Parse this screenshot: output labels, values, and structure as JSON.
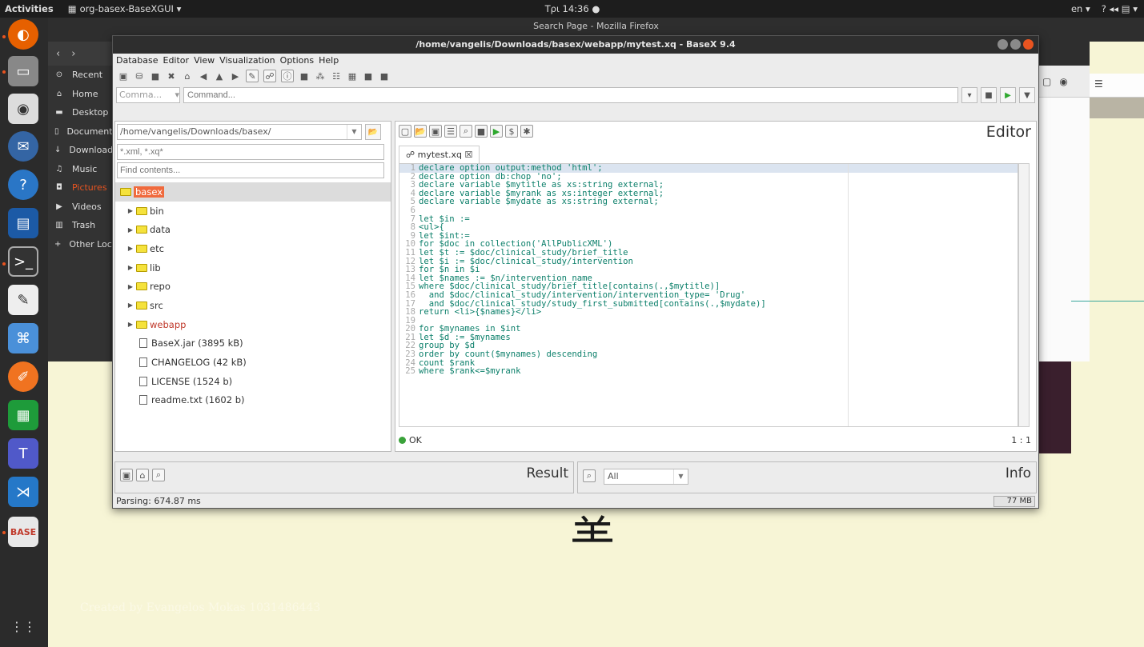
{
  "topbar": {
    "activities": "Activities",
    "app_name": "org-basex-BaseXGUI ▾",
    "clock": "Τρι 14:36 ●",
    "lang": "en ▾",
    "tray": "? ◂◂ ▤ ▾"
  },
  "firefox": {
    "title": "Search Page - Mozilla Firefox"
  },
  "files_sidebar": [
    {
      "icon": "⊙",
      "label": "Recent"
    },
    {
      "icon": "⌂",
      "label": "Home"
    },
    {
      "icon": "▬",
      "label": "Desktop"
    },
    {
      "icon": "▯",
      "label": "Documents"
    },
    {
      "icon": "↓",
      "label": "Downloads"
    },
    {
      "icon": "♫",
      "label": "Music"
    },
    {
      "icon": "◘",
      "label": "Pictures"
    },
    {
      "icon": "▶",
      "label": "Videos"
    },
    {
      "icon": "▥",
      "label": "Trash"
    },
    {
      "icon": "+",
      "label": "Other Locations"
    }
  ],
  "basex": {
    "title": "/home/vangelis/Downloads/basex/webapp/mytest.xq - BaseX 9.4",
    "menu": [
      "Database",
      "Editor",
      "View",
      "Visualization",
      "Options",
      "Help"
    ],
    "command_mode": "Comma...",
    "command_placeholder": "Command...",
    "path": "/home/vangelis/Downloads/basex/",
    "filter_placeholder": "*.xml, *.xq*",
    "find_placeholder": "Find contents...",
    "tree": [
      {
        "label": "basex",
        "type": "root"
      },
      {
        "label": "bin",
        "type": "folder"
      },
      {
        "label": "data",
        "type": "folder"
      },
      {
        "label": "etc",
        "type": "folder"
      },
      {
        "label": "lib",
        "type": "folder"
      },
      {
        "label": "repo",
        "type": "folder"
      },
      {
        "label": "src",
        "type": "folder"
      },
      {
        "label": "webapp",
        "type": "folder-red"
      },
      {
        "label": "BaseX.jar (3895 kB)",
        "type": "file"
      },
      {
        "label": "CHANGELOG (42 kB)",
        "type": "file"
      },
      {
        "label": "LICENSE (1524 b)",
        "type": "file"
      },
      {
        "label": "readme.txt (1602 b)",
        "type": "file"
      }
    ],
    "editor_title": "Editor",
    "tab_label": "mytest.xq ☒",
    "code": [
      "declare option output:method 'html';",
      "declare option db:chop 'no';",
      "declare variable $mytitle as xs:string external;",
      "declare variable $myrank as xs:integer external;",
      "declare variable $mydate as xs:string external;",
      "",
      "let $in :=",
      "<ul>{",
      "let $int:=",
      "for $doc in collection('AllPublicXML')",
      "let $t := $doc/clinical_study/brief_title",
      "let $i := $doc/clinical_study/intervention",
      "for $n in $i",
      "let $names := $n/intervention_name",
      "where $doc/clinical_study/brief_title[contains(.,$mytitle)]",
      "  and $doc/clinical_study/intervention/intervention_type= 'Drug'",
      "  and $doc/clinical_study/study_first_submitted[contains(.,$mydate)]",
      "return <li>{$names}</li>",
      "",
      "for $mynames in $int",
      "let $d := $mynames",
      "group by $d",
      "order by count($mynames) descending",
      "count $rank",
      "where $rank<=$myrank"
    ],
    "status_ok": "OK",
    "cursor_pos": "1 : 1",
    "result_title": "Result",
    "info_title": "Info",
    "info_filter": "All",
    "parsing_status": "Parsing: 674.87 ms",
    "memory": "77 MB"
  },
  "desktop": {
    "watermark": "Created by Evangelos Mokas 1031486443"
  }
}
